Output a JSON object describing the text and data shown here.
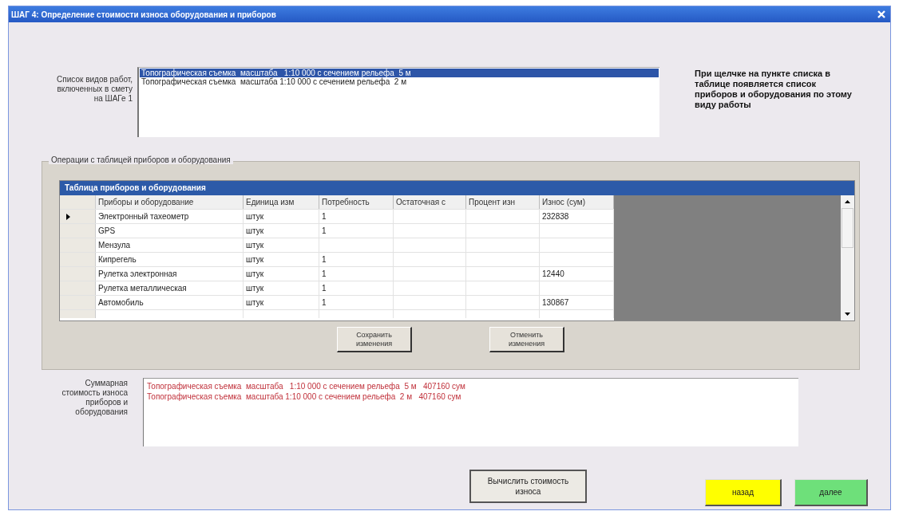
{
  "window": {
    "title": "ШАГ 4: Определение стоимости износа оборудования и приборов"
  },
  "works": {
    "label": "Список видов работ, включенных в смету на ШАГе 1",
    "items": [
      {
        "text": "Топографическая съемка  масштаба   1:10 000 с сечением рельефа  5 м",
        "selected": true
      },
      {
        "text": "Топографическая съемка  масштаба 1:10 000 с сечением рельефа  2 м",
        "selected": false
      }
    ]
  },
  "hint": "При щелчке на пункте списка в таблице появляется список приборов и оборудования по этому виду работы",
  "group": {
    "title": "Операции с таблицей приборов и оборудования",
    "table": {
      "caption": "Таблица приборов и оборудования",
      "columns": [
        "Приборы и оборудование",
        "Единица изм",
        "Потребность",
        "Остаточная с",
        "Процент изн",
        "Износ (сум)"
      ],
      "rows": [
        {
          "current": true,
          "cells": [
            "Электронный тахеометр",
            "штук",
            "1",
            "",
            "",
            "232838"
          ]
        },
        {
          "current": false,
          "cells": [
            "GPS",
            "штук",
            "1",
            "",
            "",
            ""
          ]
        },
        {
          "current": false,
          "cells": [
            "Мензула",
            "штук",
            "",
            "",
            "",
            ""
          ]
        },
        {
          "current": false,
          "cells": [
            "Кипрегель",
            "штук",
            "1",
            "",
            "",
            ""
          ]
        },
        {
          "current": false,
          "cells": [
            "Рулетка электронная",
            "штук",
            "1",
            "",
            "",
            "12440"
          ]
        },
        {
          "current": false,
          "cells": [
            "Рулетка металлическая",
            "штук",
            "1",
            "",
            "",
            ""
          ]
        },
        {
          "current": false,
          "cells": [
            "Автомобиль",
            "штук",
            "1",
            "",
            "",
            "130867"
          ]
        }
      ]
    },
    "buttons": [
      "Сохранить изменения",
      "Отменить изменения"
    ]
  },
  "summary": {
    "label": "Суммарная стоимость износа приборов и оборудования",
    "lines": [
      "Топографическая съемка  масштаба   1:10 000 с сечением рельефа  5 м   407160 сум",
      "Топографическая съемка  масштаба 1:10 000 с сечением рельефа  2 м   407160 сум"
    ]
  },
  "buttons": [
    {
      "kind": "plain",
      "label": "Вычислить стоимость износа"
    },
    {
      "kind": "back",
      "label": "назад"
    },
    {
      "kind": "next",
      "label": "далее"
    }
  ]
}
